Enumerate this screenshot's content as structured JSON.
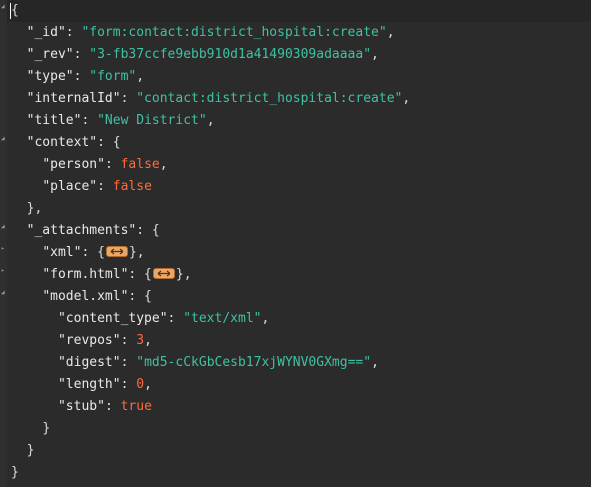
{
  "document": {
    "id_key": "\"_id\"",
    "id_value": "\"form:contact:district_hospital:create\"",
    "rev_key": "\"_rev\"",
    "rev_value": "\"3-fb37ccfe9ebb910d1a41490309adaaaa\"",
    "type_key": "\"type\"",
    "type_value": "\"form\"",
    "internalId_key": "\"internalId\"",
    "internalId_value": "\"contact:district_hospital:create\"",
    "title_key": "\"title\"",
    "title_value": "\"New District\"",
    "context_key": "\"context\"",
    "person_key": "\"person\"",
    "person_value": "false",
    "place_key": "\"place\"",
    "place_value": "false",
    "attachments_key": "\"_attachments\"",
    "xml_key": "\"xml\"",
    "formhtml_key": "\"form.html\"",
    "modelxml_key": "\"model.xml\"",
    "content_type_key": "\"content_type\"",
    "content_type_value": "\"text/xml\"",
    "revpos_key": "\"revpos\"",
    "revpos_value": "3",
    "digest_key": "\"digest\"",
    "digest_value": "\"md5-cCkGbCesb17xjWYNV0GXmg==\"",
    "length_key": "\"length\"",
    "length_value": "0",
    "stub_key": "\"stub\"",
    "stub_value": "true"
  },
  "icons": {
    "fold": "fold-triangle-icon",
    "collapsed": "collapsed-ellipsis-icon"
  },
  "colors": {
    "background": "#2b2b2b",
    "string": "#3fc1a4",
    "literal": "#ff6a3c",
    "key": "#e8e8e8",
    "collapsed_badge": "#e9a86a"
  }
}
